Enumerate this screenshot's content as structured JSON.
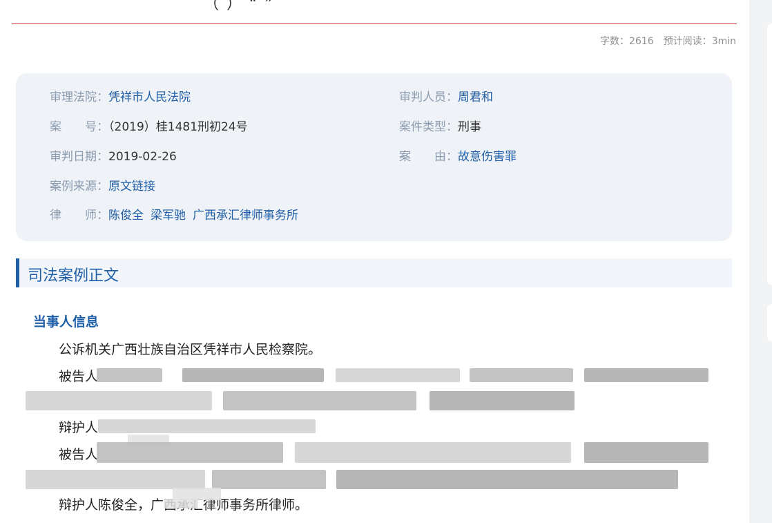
{
  "header": {
    "title_fragment": "（        ）            “                   ”",
    "word_count_label": "字数：",
    "word_count": "2616",
    "read_time_label": "预计阅读：",
    "read_time": "3min"
  },
  "case_info": {
    "court_label": "审理法院：",
    "court": "凭祥市人民法院",
    "judge_label": "审判人员：",
    "judge": "周君和",
    "case_no_label": "案　　号：",
    "case_no": "（2019）桂1481刑初24号",
    "case_type_label": "案件类型：",
    "case_type": "刑事",
    "date_label": "审判日期：",
    "date": "2019-02-26",
    "cause_label": "案　　由：",
    "cause": "故意伤害罪",
    "source_label": "案例来源：",
    "source": "原文链接",
    "lawyers_label": "律　　师：",
    "lawyers": [
      "陈俊全",
      "梁军驰",
      "广西承汇律师事务所"
    ]
  },
  "section": {
    "title": "司法案例正文",
    "subtitle": "当事人信息"
  },
  "paragraphs": [
    "公诉机关广西壮族自治区凭祥市人民检察院。",
    "被告人",
    "辩护人",
    "被告人",
    "辩护人陈俊全，广西承汇律师事务所律师。"
  ],
  "colors": {
    "accent": "#1f5fa8",
    "rule": "#d9333f",
    "info_bg": "#eff2f6",
    "label": "#8b9bb0"
  }
}
